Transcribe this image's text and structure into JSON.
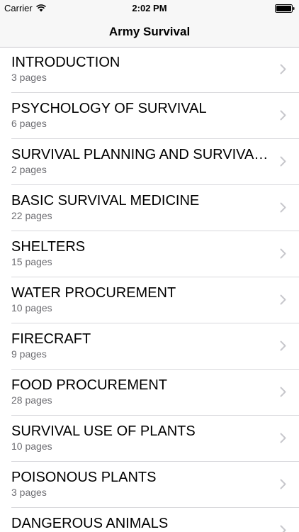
{
  "status_bar": {
    "carrier": "Carrier",
    "time": "2:02 PM",
    "wifi_icon": "wifi-icon",
    "battery_icon": "battery-icon"
  },
  "nav": {
    "title": "Army Survival"
  },
  "chapters": [
    {
      "title": "INTRODUCTION",
      "pages": "3 pages"
    },
    {
      "title": "PSYCHOLOGY OF SURVIVAL",
      "pages": "6 pages"
    },
    {
      "title": "SURVIVAL PLANNING AND SURVIVAL...",
      "pages": "2 pages"
    },
    {
      "title": "BASIC SURVIVAL MEDICINE",
      "pages": "22 pages"
    },
    {
      "title": "SHELTERS",
      "pages": "15 pages"
    },
    {
      "title": "WATER PROCUREMENT",
      "pages": "10 pages"
    },
    {
      "title": "FIRECRAFT",
      "pages": "9 pages"
    },
    {
      "title": "FOOD PROCUREMENT",
      "pages": "28 pages"
    },
    {
      "title": "SURVIVAL USE OF PLANTS",
      "pages": "10 pages"
    },
    {
      "title": "POISONOUS PLANTS",
      "pages": "3 pages"
    },
    {
      "title": "DANGEROUS ANIMALS",
      "pages": ""
    }
  ],
  "colors": {
    "bar_background": "#f7f7f7",
    "separator": "#d8d8dc",
    "subtitle": "#6d6d72",
    "chevron": "#c7c7cc"
  }
}
